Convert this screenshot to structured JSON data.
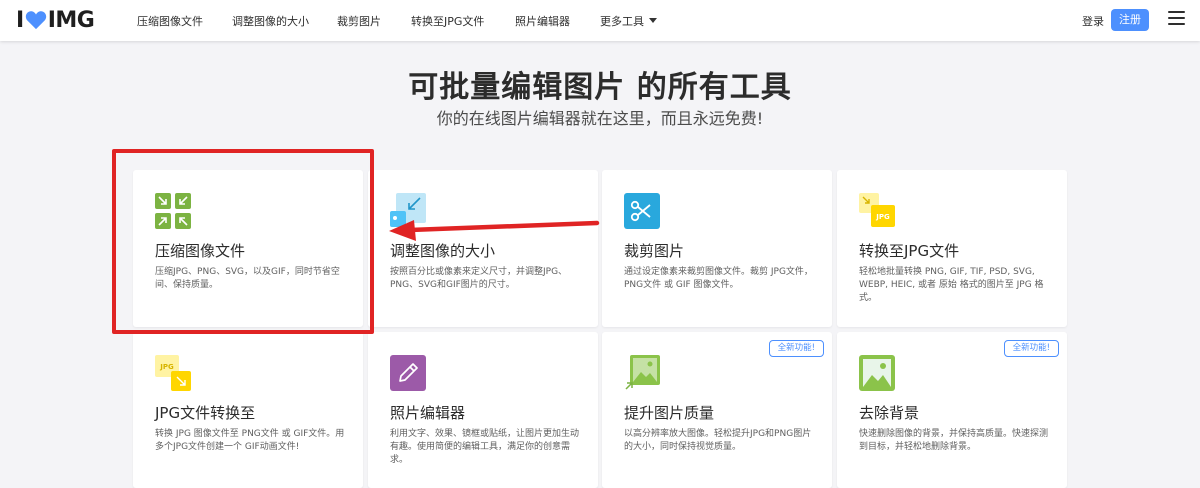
{
  "header": {
    "logo_left": "I",
    "logo_right": "IMG",
    "nav": [
      "压缩图像文件",
      "调整图像的大小",
      "裁剪图片",
      "转换至JPG文件",
      "照片编辑器"
    ],
    "more": "更多工具",
    "login": "登录",
    "signup": "注册"
  },
  "hero": {
    "title": "可批量编辑图片 的所有工具",
    "subtitle": "你的在线图片编辑器就在这里，而且永远免费!"
  },
  "tools": [
    {
      "title": "压缩图像文件",
      "desc": "压缩JPG、PNG、SVG，以及GIF，同时节省空间、保持质量。",
      "icon": "compress-icon"
    },
    {
      "title": "调整图像的大小",
      "desc": "按照百分比或像素来定义尺寸，并调整JPG、PNG、SVG和GIF图片的尺寸。",
      "icon": "resize-icon"
    },
    {
      "title": "裁剪图片",
      "desc": "通过设定像素来裁剪图像文件。裁剪 JPG文件，PNG文件 或 GIF 图像文件。",
      "icon": "scissors-icon"
    },
    {
      "title": "转换至JPG文件",
      "desc": "轻松地批量转换 PNG, GIF, TIF, PSD, SVG, WEBP, HEIC, 或者 原始 格式的图片至 JPG 格式。",
      "icon": "to-jpg-icon"
    },
    {
      "title": "JPG文件转换至",
      "desc": "转换 JPG 图像文件至 PNG文件 或 GIF文件。用多个JPG文件创建一个 GIF动画文件!",
      "icon": "from-jpg-icon"
    },
    {
      "title": "照片编辑器",
      "desc": "利用文字、效果、镜框或贴纸，让图片更加生动有趣。使用简便的编辑工具，满足你的创意需求。",
      "icon": "pencil-icon"
    },
    {
      "title": "提升图片质量",
      "desc": "以高分辨率放大图像。轻松提升JPG和PNG图片的大小，同时保持视觉质量。",
      "icon": "upscale-icon",
      "badge": "全新功能!"
    },
    {
      "title": "去除背景",
      "desc": "快速删除图像的背景，并保持高质量。快速探测到目标，并轻松地删除背景。",
      "icon": "remove-bg-icon",
      "badge": "全新功能!"
    }
  ],
  "icon_texts": {
    "jpg": "JPG"
  },
  "colors": {
    "accent": "#4d90fe",
    "annotation": "#e02424",
    "compress": "#7cb342",
    "resize": "#4fc3f7",
    "crop": "#29a8dd",
    "convert": "#ffd600",
    "editor": "#9c5aa8",
    "upscale": "#8bc34a",
    "remove_bg": "#8bc34a"
  }
}
